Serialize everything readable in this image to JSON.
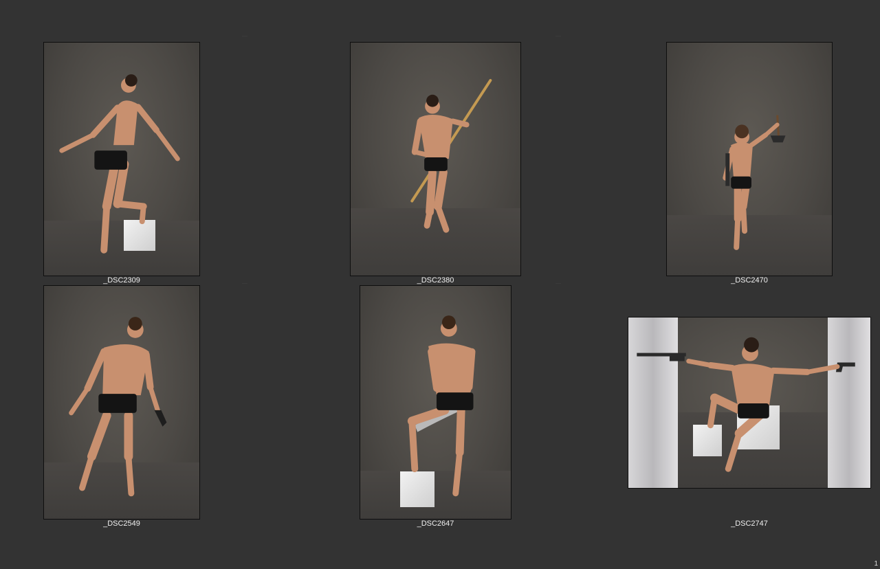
{
  "contact_sheet": {
    "page_number": "1",
    "photos": [
      {
        "caption": "_DSC2309",
        "subject": "man leaning back, arms spread, one foot raised on white box"
      },
      {
        "caption": "_DSC2380",
        "subject": "man holding long wooden staff diagonally"
      },
      {
        "caption": "_DSC2470",
        "subject": "man raising hatchet, one knee lifted"
      },
      {
        "caption": "_DSC2549",
        "subject": "man standing holding pistol in lowered hand"
      },
      {
        "caption": "_DSC2647",
        "subject": "man with foot on box holding machete"
      },
      {
        "caption": "_DSC2747",
        "subject": "man seated on box aiming shotgun and pistol in opposite directions"
      }
    ]
  },
  "colors": {
    "background": "#333333",
    "caption_text": "#f0f0f0",
    "photo_border": "#0e0e0e",
    "backdrop_gray": "#4c4945",
    "skin": "#c8906f",
    "trunks": "#141414"
  }
}
